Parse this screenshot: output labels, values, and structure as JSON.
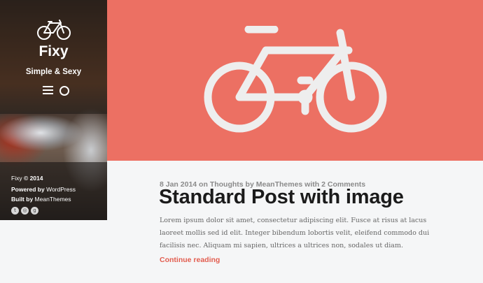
{
  "sidebar": {
    "site_title": "Fixy",
    "tagline": "Simple & Sexy",
    "icons": {
      "logo": "bicycle-icon",
      "menu": "hamburger-menu-icon",
      "search": "search-icon"
    },
    "footer": {
      "site_name": "Fixy",
      "copyright_suffix": " © 2014",
      "powered_prefix": "Powered by ",
      "powered_link": "WordPress",
      "built_prefix": "Built by ",
      "built_link": "MeanThemes"
    },
    "social": [
      {
        "name": "twitter-icon",
        "glyph": "t"
      },
      {
        "name": "dribbble-icon",
        "glyph": "◎"
      },
      {
        "name": "github-icon",
        "glyph": "g"
      }
    ]
  },
  "hero": {
    "background_color": "#ec7063",
    "icon": "bicycle-icon",
    "icon_color": "#eeeeee"
  },
  "post": {
    "date": "8 Jan 2014",
    "on": " on ",
    "category": "Thoughts",
    "by": " by ",
    "author": "MeanThemes",
    "with": " with ",
    "comments": "2 Comments",
    "title": "Standard Post with image",
    "excerpt": "Lorem ipsum dolor sit amet, consectetur adipiscing elit. Fusce at risus at lacus laoreet mollis sed id elit. Integer bibendum lobortis velit, eleifend commodo dui facilisis nec. Aliquam mi sapien, ultrices a ultrices non, sodales ut diam.",
    "continue_label": "Continue reading"
  },
  "colors": {
    "accent": "#e25d4f",
    "hero": "#ec7063",
    "title": "#1b1b1b",
    "meta": "#8a8a8a"
  }
}
